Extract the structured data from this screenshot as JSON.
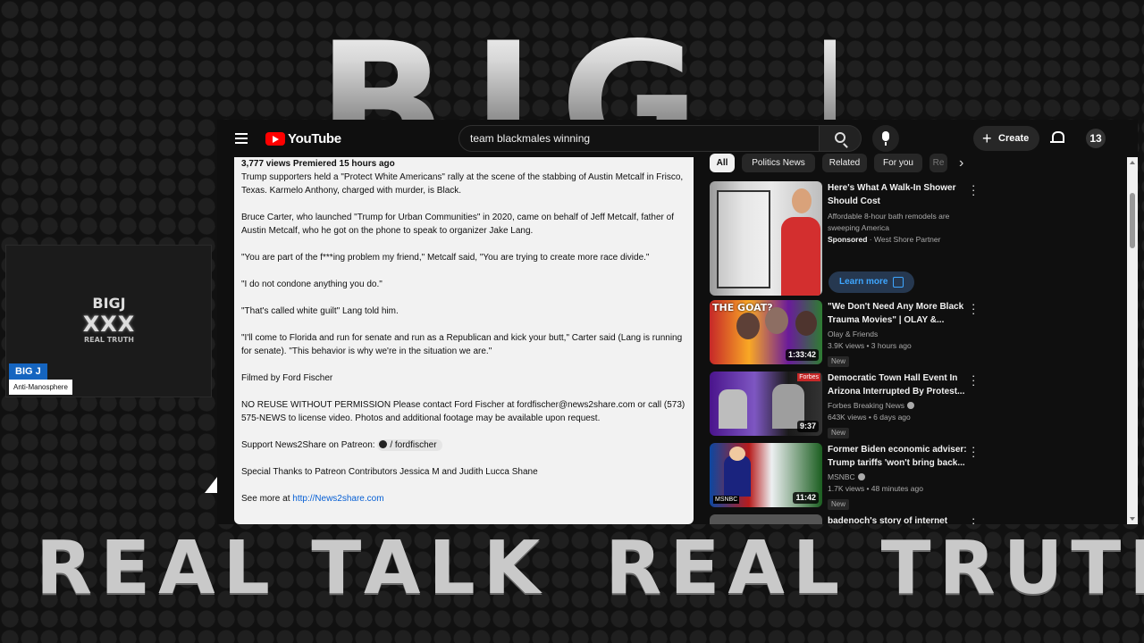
{
  "overlay": {
    "top_banner": "BIG J",
    "bottom_left": "REAL TALK",
    "bottom_right": "REAL TRUTH",
    "cam_logo": {
      "line1": "BIGJ",
      "line2": "XXX",
      "line3": "REAL TRUTH"
    },
    "cam_name": "BIG J",
    "cam_subtitle": "Anti-Manosphere"
  },
  "header": {
    "logo_text": "YouTube",
    "search_value": "team blackmales winning",
    "create_label": "Create",
    "avatar_text": "13"
  },
  "description": {
    "meta": "3,777 views  Premiered 15 hours ago",
    "paragraphs": [
      "Trump supporters held a \"Protect White Americans\" rally at the scene of the stabbing of Austin Metcalf in Frisco, Texas. Karmelo Anthony, charged with murder, is Black.",
      "Bruce Carter, who launched \"Trump for Urban Communities\" in 2020, came on behalf of Jeff Metcalf, father of Austin Metcalf, who he got on the phone to speak to organizer Jake Lang.",
      "\"You are part of the f***ing problem my friend,\" Metcalf said, \"You are trying to create more race divide.\"",
      "\"I do not condone anything you do.\"",
      "\"That's called white guilt\" Lang told him.",
      "\"I'll come to Florida and run for senate and run as a Republican and kick your butt,\" Carter said (Lang is running for senate). \"This behavior is why we're in the situation we are.\"",
      "Filmed by Ford Fischer",
      "NO REUSE WITHOUT PERMISSION Please contact Ford Fischer at fordfischer@news2share.com or call (573) 575-NEWS to license video. Photos and additional footage may be available upon request."
    ],
    "patreon_prefix": "Support News2Share on Patreon:",
    "patreon_link": "/ fordfischer",
    "thanks": "Special Thanks to Patreon Contributors Jessica M and Judith Lucca Shane",
    "see_more_prefix": "See more at",
    "see_more_link": "http://News2share.com"
  },
  "chips": [
    "All",
    "Politics News",
    "Related",
    "For you",
    "Re"
  ],
  "ad": {
    "title": "Here's What A Walk-In Shower Should Cost",
    "desc": "Affordable 8-hour bath remodels are sweeping America",
    "sponsored": "Sponsored",
    "advertiser": "· West Shore Partner",
    "cta": "Learn more"
  },
  "recommendations": [
    {
      "title": "\"We Don't Need Any More Black Trauma Movies\" | OLAY &...",
      "channel": "Olay & Friends",
      "stats": "3.9K views • 3 hours ago",
      "badge": "New",
      "duration": "1:33:42"
    },
    {
      "title": "Democratic Town Hall Event In Arizona Interrupted By Protest...",
      "channel": "Forbes Breaking News",
      "stats": "643K views • 6 days ago",
      "badge": "New",
      "duration": "9:37"
    },
    {
      "title": "Former Biden economic adviser: Trump tariffs 'won't bring back...",
      "channel": "MSNBC",
      "stats": "1.7K views • 48 minutes ago",
      "badge": "New",
      "duration": "11:42"
    },
    {
      "title": "badenoch's story of internet",
      "channel": "",
      "stats": "",
      "badge": "",
      "duration": ""
    }
  ],
  "thumb_texts": {
    "goat": "THE GOAT?",
    "forbes": "Forbes",
    "msnbc": "MSNBC"
  },
  "colors": {
    "yt_bg": "#0f0f0f",
    "brand_red": "#ff0000",
    "link_blue": "#065fd4",
    "cam_blue": "#1565c0"
  }
}
